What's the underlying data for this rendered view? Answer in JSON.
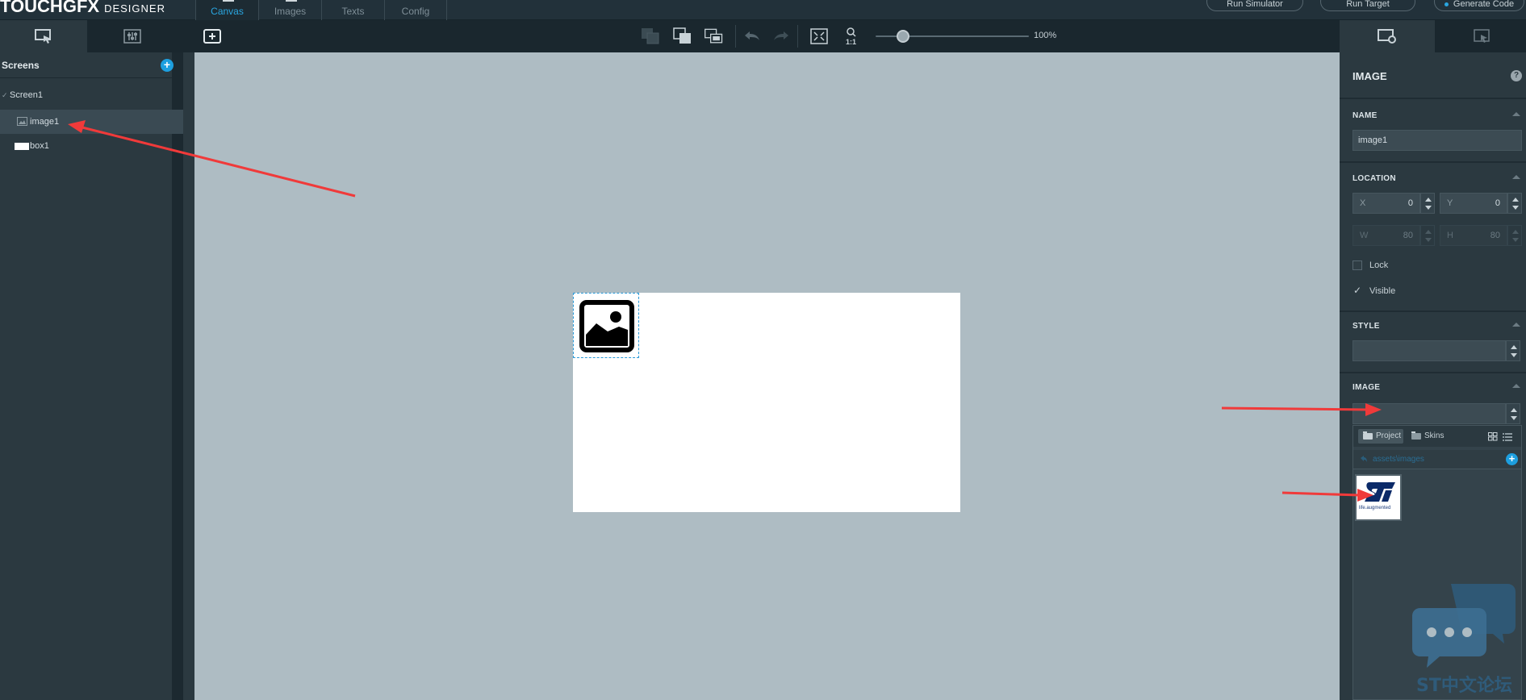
{
  "app": {
    "logo_main": "TOUCH",
    "logo_gfx": "GFX",
    "logo_sub": "DESIGNER"
  },
  "nav": {
    "tabs": [
      {
        "label": "Canvas",
        "active": true
      },
      {
        "label": "Images",
        "active": false
      },
      {
        "label": "Texts",
        "active": false
      },
      {
        "label": "Config",
        "active": false
      }
    ]
  },
  "top_buttons": {
    "run_simulator": "Run Simulator",
    "run_target": "Run Target",
    "generate_code": "Generate Code"
  },
  "toolbar": {
    "zoom_value": "100%",
    "zoom_fraction": 0.18,
    "actual_size_label": "1:1"
  },
  "left_panel": {
    "title": "Screens",
    "tree": [
      {
        "label": "Screen1",
        "type": "screen",
        "selected": false
      },
      {
        "label": "image1",
        "type": "image",
        "selected": true
      },
      {
        "label": "box1",
        "type": "box",
        "selected": false
      }
    ]
  },
  "properties": {
    "widget_type": "IMAGE",
    "help": "?",
    "name_section": "NAME",
    "name_value": "image1",
    "location_section": "LOCATION",
    "x_label": "X",
    "x_value": "0",
    "y_label": "Y",
    "y_value": "0",
    "w_label": "W",
    "w_value": "80",
    "h_label": "H",
    "h_value": "80",
    "lock_label": "Lock",
    "lock_checked": false,
    "visible_label": "Visible",
    "visible_checked": true,
    "style_section": "STYLE",
    "style_value": "",
    "image_section": "IMAGE",
    "image_value": ""
  },
  "image_browser": {
    "tab_project": "Project",
    "tab_skins": "Skins",
    "path": "assets\\images",
    "thumbnail_caption": "life.augmented"
  },
  "watermark": {
    "text": "ST中文论坛"
  },
  "colors": {
    "accent": "#2aa6e0",
    "canvas_bg": "#aebcc3",
    "panel_bg": "#2b3940",
    "arrow": "#f03a3a"
  }
}
